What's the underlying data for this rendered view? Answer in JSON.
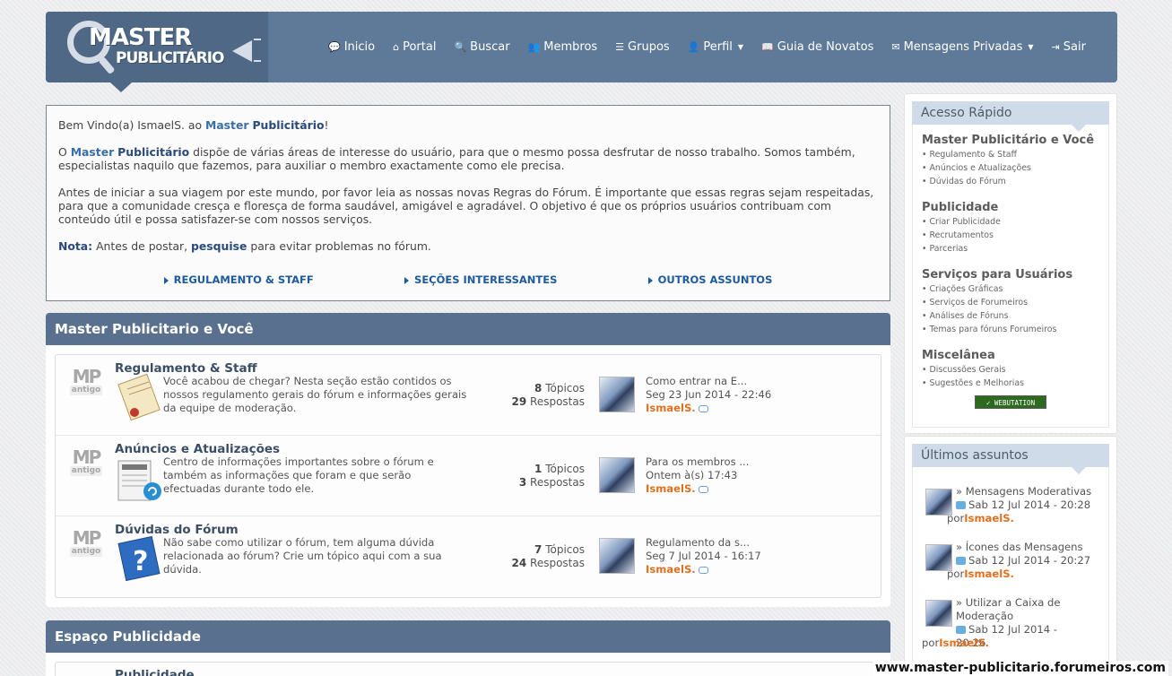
{
  "logo": {
    "line1": "MASTER",
    "line2": "PUBLICITÁRIO"
  },
  "nav": [
    {
      "label": "Inicio",
      "icon": "💬"
    },
    {
      "label": "Portal",
      "icon": "⌂"
    },
    {
      "label": "Buscar",
      "icon": "🔍"
    },
    {
      "label": "Membros",
      "icon": "👥"
    },
    {
      "label": "Grupos",
      "icon": "☰"
    },
    {
      "label": "Perfil",
      "icon": "👤"
    },
    {
      "label": "Guia de Novatos",
      "icon": "📖"
    },
    {
      "label": "Mensagens Privadas",
      "icon": "✉"
    },
    {
      "label": "Sair",
      "icon": "⇥"
    }
  ],
  "welcome": {
    "p1_pre": "Bem Vindo(a) IsmaelS. ao ",
    "brand1": "Master",
    "brand2": "Publicitário",
    "p1_post": "!",
    "p2_pre": "O ",
    "p2_post": " dispõe de várias áreas de interesse do usuário, para que o mesmo possa desfrutar de nosso trabalho. Somos também, especialistas naquilo que fazemos, para auxiliar o membro exactamente como ele precisa.",
    "p3": "Antes de iniciar a sua viagem por este mundo, por favor leia as nossas novas Regras do Fórum. É importante que essas regras sejam respeitadas, para que a comunidade cresça e floresça de forma saudável, amigável e agradável. O objetivo é que os próprios usuários contribuam com conteúdo útil e possa satisfazer-se com nossos serviços.",
    "note_label": "Nota:",
    "note_pre": " Antes de postar, ",
    "note_link": "pesquise",
    "note_post": " para evitar problemas no fórum.",
    "links": [
      "REGULAMENTO & STAFF",
      "SEÇÕES INTERESSANTES",
      "OUTROS ASSUNTOS"
    ]
  },
  "category1": {
    "title": "Master Publicitario e Você",
    "forums": [
      {
        "mp": "MP",
        "badge": "antigo",
        "title": "Regulamento & Staff",
        "desc": "Você acabou de chegar? Nesta seção estão contidos os nossos regulamento gerais do fórum e informações gerais da equipe de moderação.",
        "topics": "8",
        "topics_label": " Tópicos",
        "replies": "29",
        "replies_label": " Respostas",
        "last_title": "Como entrar na E...",
        "last_date": "Seg 23 Jun 2014 - 22:46",
        "last_user": "IsmaelS."
      },
      {
        "mp": "MP",
        "badge": "antigo",
        "title": "Anúncios e Atualizações",
        "desc": "Centro de informações importantes sobre o fórum e também as informações que foram e que serão efectuadas durante todo ele.",
        "topics": "1",
        "topics_label": " Tópicos",
        "replies": "3",
        "replies_label": " Respostas",
        "last_title": "Para os membros ...",
        "last_date": "Ontem à(s) 17:43",
        "last_user": "IsmaelS."
      },
      {
        "mp": "MP",
        "badge": "antigo",
        "title": "Dúvidas do Fórum",
        "desc": "Não sabe como utilizar o fórum, tem alguma dúvida relacionada ao fórum? Crie um tópico aqui com a sua dúvida.",
        "topics": "7",
        "topics_label": " Tópicos",
        "replies": "24",
        "replies_label": " Respostas",
        "last_title": "Regulamento da s...",
        "last_date": "Seg 7 Jul 2014 - 16:17",
        "last_user": "IsmaelS."
      }
    ]
  },
  "category2": {
    "title": "Espaço Publicidade",
    "first_forum": "Publicidade"
  },
  "quick_access": {
    "title": "Acesso Rápido",
    "groups": [
      {
        "title": "Master Publicitário e Você",
        "links": [
          "• Regulamento & Staff",
          "• Anúncios e Atualizações",
          "• Dúvidas do Fórum"
        ]
      },
      {
        "title": "Publicidade",
        "links": [
          "• Criar Publicidade",
          "• Recrutamentos",
          "• Parcerias"
        ]
      },
      {
        "title": "Serviços para Usuários",
        "links": [
          "• Criações Gráficas",
          "• Serviços de Forumeiros",
          "• Análises de Fóruns",
          "• Temas para fóruns Forumeiros"
        ]
      },
      {
        "title": "Miscelânea",
        "links": [
          "• Discussões Gerais",
          "• Sugestões e Melhorias"
        ]
      }
    ],
    "badge": "✓ WEBUTATION"
  },
  "latest": {
    "title": "Últimos assuntos",
    "topics": [
      {
        "title": "» Mensagens Moderativas",
        "date": "Sab 12 Jul 2014 - 20:28",
        "by": "por",
        "user": "IsmaelS."
      },
      {
        "title": "» Ícones das Mensagens",
        "date": "Sab 12 Jul 2014 - 20:27",
        "by": "por",
        "user": "IsmaelS."
      },
      {
        "title": "» Utilizar a Caixa de Moderação",
        "date": "Sab 12 Jul 2014 - 20:26",
        "by": "por",
        "user": "IsmaelS."
      }
    ]
  },
  "watermark": "www.master-publicitario.forumeiros.com"
}
